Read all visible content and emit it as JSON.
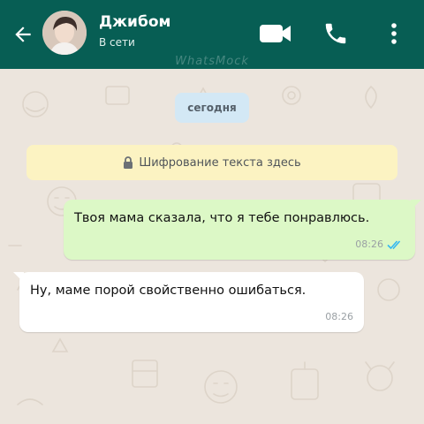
{
  "header": {
    "contact_name": "Джибом",
    "status": "В сети",
    "watermark": "WhatsMock",
    "back_icon": "arrow-left-icon",
    "video_icon": "video-camera-icon",
    "call_icon": "phone-icon",
    "menu_icon": "more-vertical-icon"
  },
  "chat": {
    "date_chip": "сегодня",
    "encryption_notice": "Шифрование текста здесь",
    "messages": [
      {
        "direction": "outgoing",
        "text": "Твоя мама сказала, что я тебе понравлюсь.",
        "time": "08:26",
        "status": "read"
      },
      {
        "direction": "incoming",
        "text": "Ну, маме порой свойственно ошибаться.",
        "time": "08:26"
      }
    ]
  },
  "colors": {
    "header": "#075e54",
    "background": "#ece5dd",
    "outgoing_bubble": "#dcf8c6",
    "incoming_bubble": "#ffffff",
    "date_chip": "#d3e8f5",
    "notice": "#fcf3c2",
    "read_ticks": "#34b7f1"
  }
}
